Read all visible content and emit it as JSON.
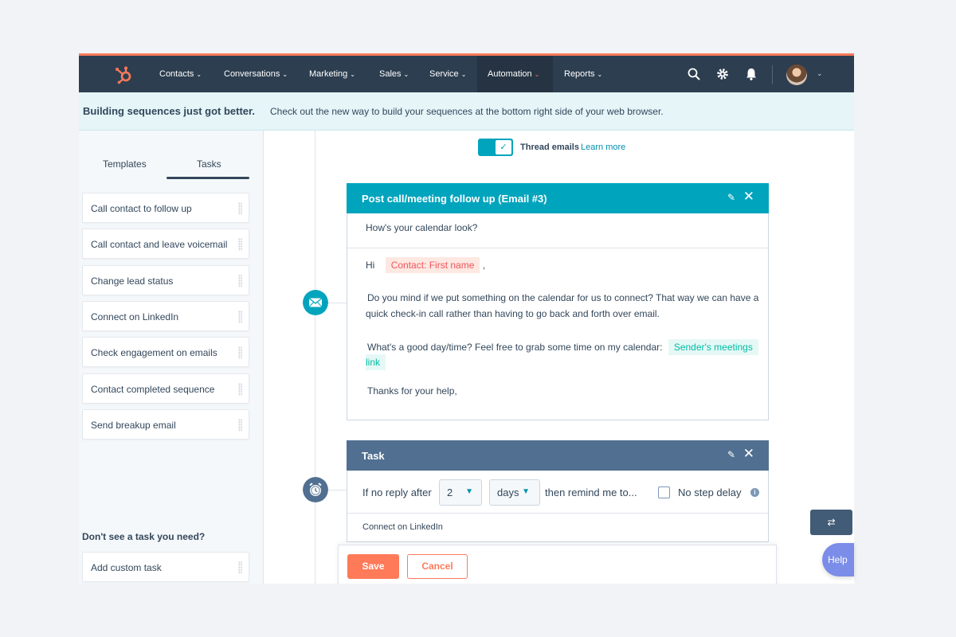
{
  "colors": {
    "nav_bg": "#2d3e50",
    "accent_orange": "#ff7a59",
    "teal": "#00a4bd",
    "task_header": "#516f90",
    "banner_bg": "#e5f5f8"
  },
  "nav": {
    "logo_icon": "hubspot-sprocket-icon",
    "items": [
      "Contacts",
      "Conversations",
      "Marketing",
      "Sales",
      "Service",
      "Automation",
      "Reports"
    ],
    "active": "Automation",
    "right_icons": [
      "search-icon",
      "gear-icon",
      "bell-icon"
    ]
  },
  "banner": {
    "title": "Building sequences just got better.",
    "text": "Check out the new way to build your sequences at the bottom right side of your web browser."
  },
  "sidebar": {
    "tabs": [
      "Templates",
      "Tasks"
    ],
    "active_tab": "Tasks",
    "tasks": [
      "Call contact to follow up",
      "Call contact and leave voicemail",
      "Change lead status",
      "Connect on LinkedIn",
      "Check engagement on emails",
      "Contact completed sequence",
      "Send breakup email"
    ],
    "missing_heading": "Don't see a task you need?",
    "custom_task": "Add custom task"
  },
  "thread": {
    "label": "Thread emails",
    "link": "Learn more",
    "enabled": true
  },
  "email_card": {
    "title": "Post call/meeting follow up (Email #3)",
    "subject": "How's your calendar look?",
    "greeting": "Hi",
    "contact_token": "Contact: First name",
    "comma": ",",
    "paragraph1_line1": "Do you mind if we put something on the calendar for us to connect? That way we can have a",
    "paragraph1_line2": "quick check-in call rather than having to go back and forth over email.",
    "paragraph2": "What's a good day/time? Feel free to grab some time on my calendar:",
    "meetings_token_1": "Sender's meetings",
    "meetings_token_2": "link",
    "closing": "Thanks for your help,"
  },
  "task_card": {
    "title": "Task",
    "if_no_reply": "If no reply after",
    "delay_value": "2",
    "delay_unit": "days",
    "then_remind": "then remind me to...",
    "no_step_delay": "No step delay",
    "no_step_delay_checked": false,
    "task_name": "Connect on LinkedIn"
  },
  "footer": {
    "save": "Save",
    "cancel": "Cancel"
  },
  "floating": {
    "swap_glyph": "⇄",
    "help": "Help"
  }
}
